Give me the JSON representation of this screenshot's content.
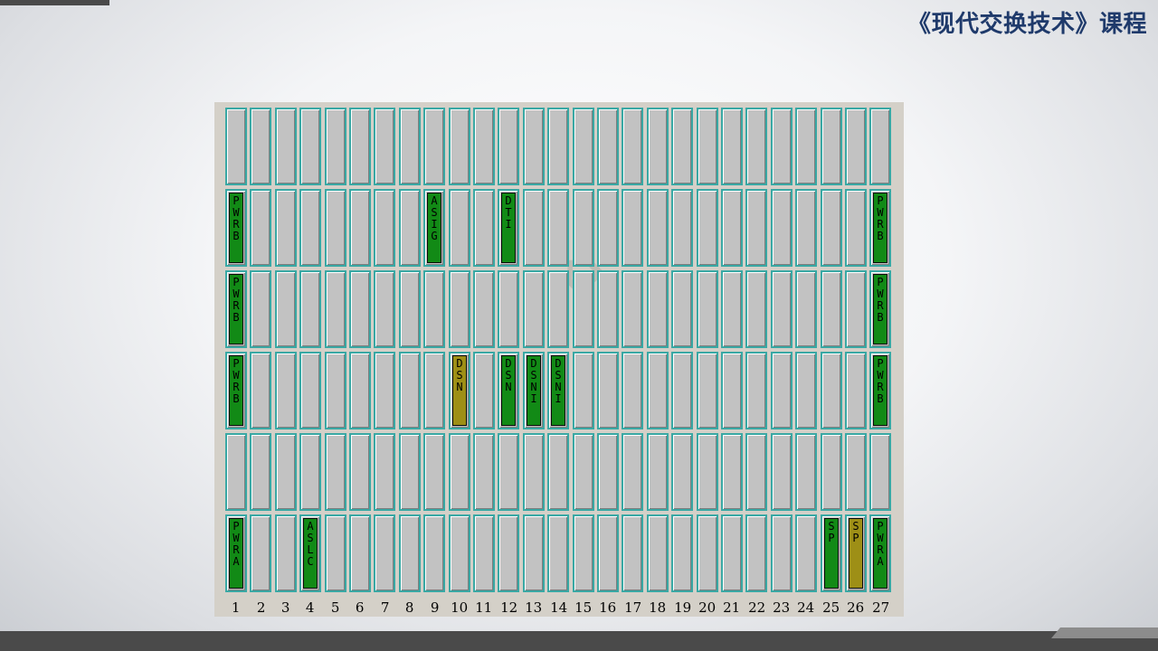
{
  "header": {
    "course_title": "《现代交换技术》课程"
  },
  "rack": {
    "slot_numbers": [
      "1",
      "2",
      "3",
      "4",
      "5",
      "6",
      "7",
      "8",
      "9",
      "10",
      "11",
      "12",
      "13",
      "14",
      "15",
      "16",
      "17",
      "18",
      "19",
      "20",
      "21",
      "22",
      "23",
      "24",
      "25",
      "26",
      "27"
    ],
    "rows": [
      [],
      [
        {
          "slot": 1,
          "label": "PWRB",
          "color": "#128a16"
        },
        {
          "slot": 9,
          "label": "ASIG",
          "color": "#128a16"
        },
        {
          "slot": 12,
          "label": "DTI",
          "color": "#128a16"
        },
        {
          "slot": 27,
          "label": "PWRB",
          "color": "#128a16"
        }
      ],
      [
        {
          "slot": 1,
          "label": "PWRB",
          "color": "#128a16"
        },
        {
          "slot": 27,
          "label": "PWRB",
          "color": "#128a16"
        }
      ],
      [
        {
          "slot": 1,
          "label": "PWRB",
          "color": "#128a16"
        },
        {
          "slot": 10,
          "label": "DSN",
          "color": "#9e8f16"
        },
        {
          "slot": 12,
          "label": "DSN",
          "color": "#128a16"
        },
        {
          "slot": 13,
          "label": "DSNI",
          "color": "#128a16"
        },
        {
          "slot": 14,
          "label": "DSNI",
          "color": "#128a16"
        },
        {
          "slot": 27,
          "label": "PWRB",
          "color": "#128a16"
        }
      ],
      [],
      [
        {
          "slot": 1,
          "label": "PWRA",
          "color": "#128a16"
        },
        {
          "slot": 4,
          "label": "ASLC",
          "color": "#128a16"
        },
        {
          "slot": 25,
          "label": "SP",
          "color": "#128a16"
        },
        {
          "slot": 26,
          "label": "SP",
          "color": "#9e8f16"
        },
        {
          "slot": 27,
          "label": "PWRA",
          "color": "#128a16"
        }
      ]
    ]
  }
}
